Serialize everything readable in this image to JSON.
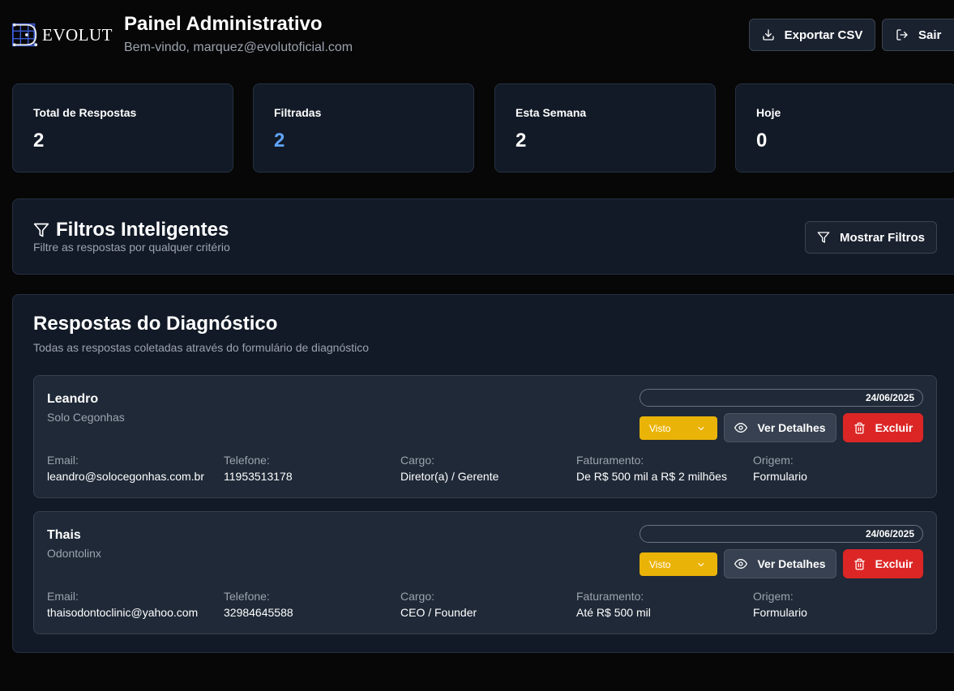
{
  "header": {
    "logo_text": "EVOLUT",
    "title": "Painel Administrativo",
    "subtitle": "Bem-vindo, marquez@evolutoficial.com",
    "export_label": "Exportar CSV",
    "logout_label": "Sair"
  },
  "stats": [
    {
      "label": "Total de Respostas",
      "value": "2"
    },
    {
      "label": "Filtradas",
      "value": "2"
    },
    {
      "label": "Esta Semana",
      "value": "2"
    },
    {
      "label": "Hoje",
      "value": "0"
    }
  ],
  "filters": {
    "title": "Filtros Inteligentes",
    "subtitle": "Filtre as respostas por qualquer critério",
    "button_label": "Mostrar Filtros"
  },
  "responses": {
    "title": "Respostas do Diagnóstico",
    "subtitle": "Todas as respostas coletadas através do formulário de diagnóstico",
    "field_labels": {
      "email": "Email:",
      "phone": "Telefone:",
      "role": "Cargo:",
      "revenue": "Faturamento:",
      "origin": "Origem:"
    },
    "details_label": "Ver Detalhes",
    "delete_label": "Excluir",
    "items": [
      {
        "name": "Leandro",
        "company": "Solo Cegonhas",
        "date": "24/06/2025",
        "status": "Visto",
        "email": "leandro@solocegonhas.com.br",
        "phone": "11953513178",
        "role": "Diretor(a) / Gerente",
        "revenue": "De R$ 500 mil a R$ 2 milhões",
        "origin": "Formulario"
      },
      {
        "name": "Thais",
        "company": "Odontolinx",
        "date": "24/06/2025",
        "status": "Visto",
        "email": "thaisodontoclinic@yahoo.com",
        "phone": "32984645588",
        "role": "CEO / Founder",
        "revenue": "Até R$ 500 mil",
        "origin": "Formulario"
      }
    ]
  },
  "colors": {
    "background": "#070707",
    "card": "#121a27",
    "accent_blue": "#60a5fa",
    "status_yellow": "#eab308",
    "delete_red": "#dc2626"
  }
}
